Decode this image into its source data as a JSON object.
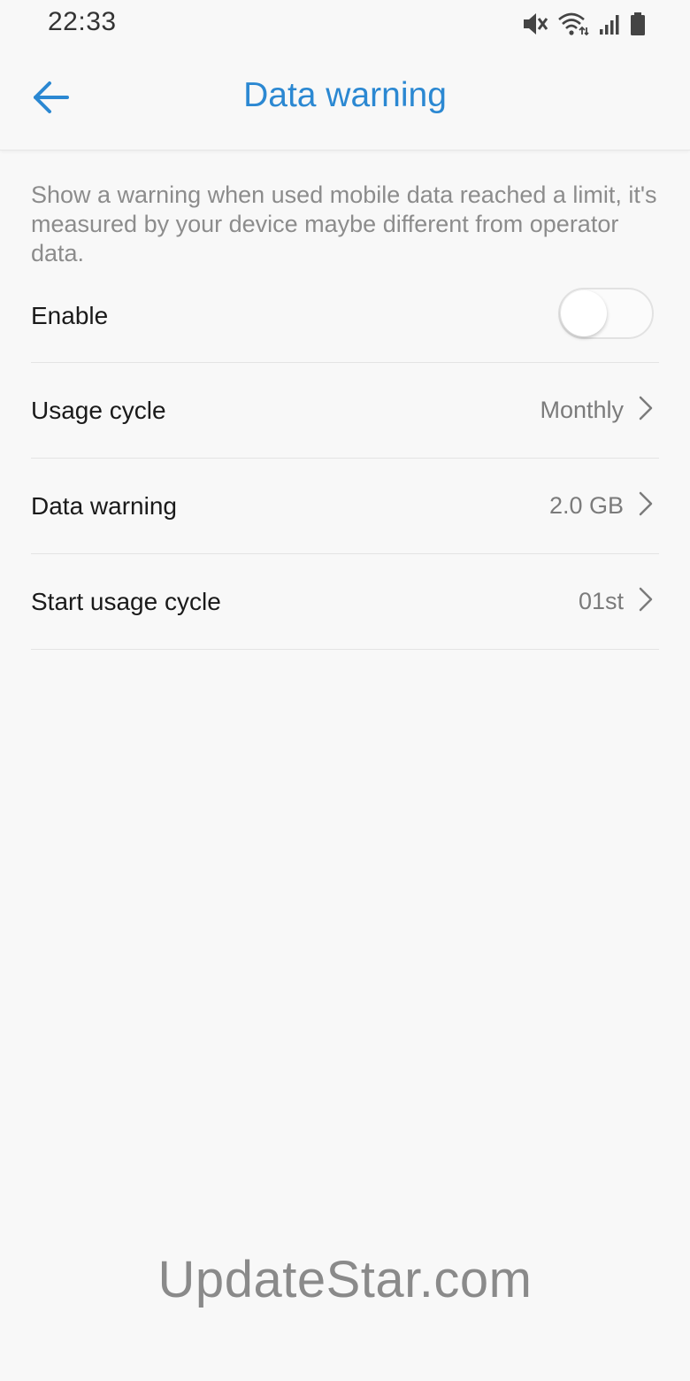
{
  "status_bar": {
    "time": "22:33",
    "icons": [
      "mute-icon",
      "wifi-icon",
      "signal-icon",
      "battery-icon"
    ]
  },
  "app_bar": {
    "title": "Data warning",
    "back_icon": "arrow-left-icon",
    "accent_color": "#2b88d2"
  },
  "content": {
    "description": "Show a warning when used mobile data reached a limit, it's measured by your device maybe different from operator data.",
    "enable": {
      "label": "Enable",
      "enabled": false
    },
    "rows": [
      {
        "label": "Usage cycle",
        "value": "Monthly",
        "icon": "chevron-right-icon"
      },
      {
        "label": "Data warning",
        "value": "2.0 GB",
        "icon": "chevron-right-icon"
      },
      {
        "label": "Start usage cycle",
        "value": "01st",
        "icon": "chevron-right-icon"
      }
    ]
  },
  "watermark": "UpdateStar.com"
}
